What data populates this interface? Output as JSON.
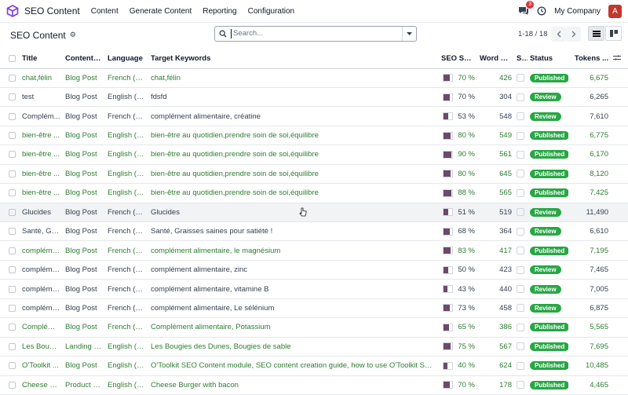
{
  "app": {
    "title": "SEO Content"
  },
  "menu": [
    "Content",
    "Generate Content",
    "Reporting",
    "Configuration"
  ],
  "topbar": {
    "badge_count": "3",
    "company": "My Company",
    "avatar_letter": "A"
  },
  "page": {
    "title": "SEO Content"
  },
  "search": {
    "placeholder": "Search..."
  },
  "pager": {
    "text": "1-18 / 18"
  },
  "columns": [
    "Title",
    "Content T...",
    "Language",
    "Target Keywords",
    "SEO Score",
    "Word Co...",
    "S...",
    "Status",
    "Tokens ..."
  ],
  "colors": {
    "published": "#28a745",
    "green_text": "#2e7d32",
    "score_bar": "#6b4a6b"
  },
  "rows": [
    {
      "title": "chat,félin",
      "type": "Blog Post",
      "lang": "French (B...",
      "keywords": "chat,félin",
      "score": 70,
      "score_text": "70 %",
      "words": "426",
      "status": "Published",
      "tokens": "6,675",
      "green": true
    },
    {
      "title": "test",
      "type": "Blog Post",
      "lang": "English (US)",
      "keywords": "fdsfd",
      "score": 70,
      "score_text": "70 %",
      "words": "304",
      "status": "Review",
      "tokens": "6,265",
      "green": false
    },
    {
      "title": "Complém...",
      "type": "Blog Post",
      "lang": "French (B...",
      "keywords": "complément alimentaire, créatine",
      "score": 53,
      "score_text": "53 %",
      "words": "548",
      "status": "Review",
      "tokens": "7,610",
      "green": false
    },
    {
      "title": "bien-être ...",
      "type": "Blog Post",
      "lang": "English (US)",
      "keywords": "bien-être au quotidien,prendre soin de soi,équilibre",
      "score": 80,
      "score_text": "80 %",
      "words": "549",
      "status": "Published",
      "tokens": "6,775",
      "green": true
    },
    {
      "title": "bien-être ...",
      "type": "Blog Post",
      "lang": "English (US)",
      "keywords": "bien-être au quotidien,prendre soin de soi,équilibre",
      "score": 90,
      "score_text": "90 %",
      "words": "561",
      "status": "Published",
      "tokens": "6,170",
      "green": true
    },
    {
      "title": "bien-être ...",
      "type": "Blog Post",
      "lang": "English (US)",
      "keywords": "bien-être au quotidien,prendre soin de soi,équilibre",
      "score": 80,
      "score_text": "80 %",
      "words": "645",
      "status": "Published",
      "tokens": "8,120",
      "green": true
    },
    {
      "title": "bien-être ...",
      "type": "Blog Post",
      "lang": "English (US)",
      "keywords": "bien-être au quotidien,prendre soin de soi,équilibre",
      "score": 88,
      "score_text": "88 %",
      "words": "565",
      "status": "Published",
      "tokens": "7,425",
      "green": true
    },
    {
      "title": "Glucides",
      "type": "Blog Post",
      "lang": "French (B...",
      "keywords": "Glucides",
      "score": 51,
      "score_text": "51 %",
      "words": "519",
      "status": "Review",
      "tokens": "11,490",
      "green": false,
      "hover": true
    },
    {
      "title": "Santé, Gra...",
      "type": "Blog Post",
      "lang": "French (B...",
      "keywords": "Santé, Graisses saines pour satiété !",
      "score": 68,
      "score_text": "68 %",
      "words": "364",
      "status": "Review",
      "tokens": "6,610",
      "green": false
    },
    {
      "title": "compléme...",
      "type": "Blog Post",
      "lang": "French (B...",
      "keywords": "complément alimentaire, le magnésium",
      "score": 83,
      "score_text": "83 %",
      "words": "417",
      "status": "Published",
      "tokens": "7,195",
      "green": true
    },
    {
      "title": "compléme...",
      "type": "Blog Post",
      "lang": "French (B...",
      "keywords": "complément alimentaire, zinc",
      "score": 50,
      "score_text": "50 %",
      "words": "423",
      "status": "Review",
      "tokens": "7,465",
      "green": false
    },
    {
      "title": "compléme...",
      "type": "Blog Post",
      "lang": "French (B...",
      "keywords": "complément alimentaire, vitamine B",
      "score": 43,
      "score_text": "43 %",
      "words": "440",
      "status": "Review",
      "tokens": "7,005",
      "green": false
    },
    {
      "title": "compléme...",
      "type": "Blog Post",
      "lang": "French (B...",
      "keywords": "complément alimentaire, Le sélénium",
      "score": 73,
      "score_text": "73 %",
      "words": "458",
      "status": "Review",
      "tokens": "6,875",
      "green": false
    },
    {
      "title": "Compléme...",
      "type": "Blog Post",
      "lang": "French (B...",
      "keywords": "Complément alimentaire, Potassium",
      "score": 65,
      "score_text": "65 %",
      "words": "386",
      "status": "Published",
      "tokens": "5,565",
      "green": true
    },
    {
      "title": "Les Bougi...",
      "type": "Landing P...",
      "lang": "English (US)",
      "keywords": "Les Bougies des Dunes, Bougies de sable",
      "score": 75,
      "score_text": "75 %",
      "words": "567",
      "status": "Published",
      "tokens": "7,695",
      "green": true
    },
    {
      "title": "O'Toolkit ...",
      "type": "Blog Post",
      "lang": "English (US)",
      "keywords": "O'Toolkit SEO Content module, SEO content creation guide, how to use O'Toolkit SEO, SE...",
      "score": 40,
      "score_text": "40 %",
      "words": "624",
      "status": "Published",
      "tokens": "10,485",
      "green": true
    },
    {
      "title": "Cheese B...",
      "type": "Product D...",
      "lang": "English (US)",
      "keywords": "Cheese Burger with bacon",
      "score": 70,
      "score_text": "70 %",
      "words": "178",
      "status": "Published",
      "tokens": "4,465",
      "green": true
    }
  ]
}
